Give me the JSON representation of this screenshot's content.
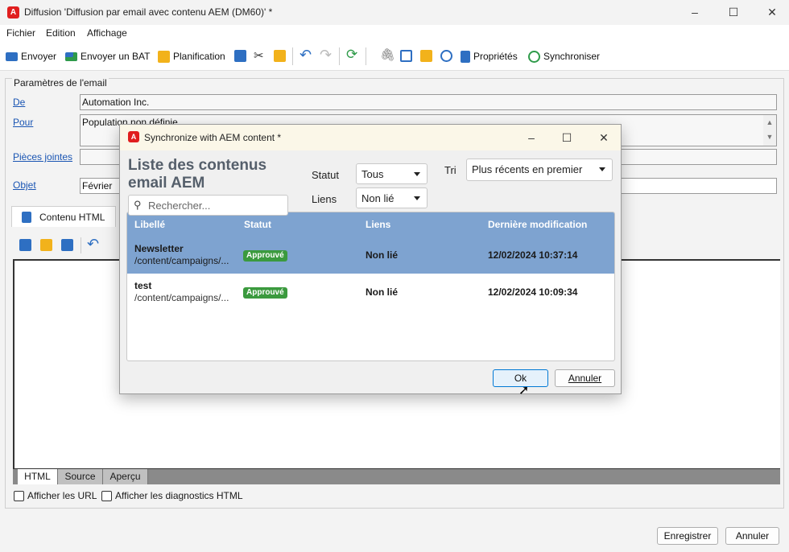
{
  "window": {
    "title": "Diffusion 'Diffusion par email avec contenu AEM (DM60)' *",
    "minimize": "–",
    "maximize": "☐",
    "close": "✕"
  },
  "menu": [
    "Fichier",
    "Edition",
    "Affichage"
  ],
  "toolbar": {
    "send": "Envoyer",
    "send_bat": "Envoyer un BAT",
    "planning": "Planification",
    "properties": "Propriétés",
    "synchronize": "Synchroniser"
  },
  "email_params": {
    "section": "Paramètres de l'email",
    "from_label": "De",
    "from_value": "Automation Inc.",
    "to_label": "Pour",
    "to_value": "Population non définie",
    "attachments_label": "Pièces jointes",
    "subject_label": "Objet",
    "subject_value": "Février"
  },
  "content_tab": "Contenu HTML",
  "bottom_tabs": [
    "HTML",
    "Source",
    "Aperçu"
  ],
  "checkboxes": {
    "show_urls": "Afficher les URL",
    "show_diagnostics": "Afficher les diagnostics HTML"
  },
  "footer": {
    "save": "Enregistrer",
    "cancel": "Annuler"
  },
  "dialog": {
    "title": "Synchronize with AEM content *",
    "heading": "Liste des contenus email AEM",
    "search_placeholder": "Rechercher...",
    "status_label": "Statut",
    "status_value": "Tous",
    "links_label": "Liens",
    "links_value": "Non lié",
    "sort_label": "Tri",
    "sort_value": "Plus récents en premier",
    "columns": [
      "Libellé",
      "Statut",
      "Liens",
      "Dernière modification"
    ],
    "rows": [
      {
        "name": "Newsletter",
        "path": "/content/campaigns/...",
        "status": "Approuvé",
        "links": "Non lié",
        "modified": "12/02/2024 10:37:14",
        "selected": true
      },
      {
        "name": "test",
        "path": "/content/campaigns/...",
        "status": "Approuvé",
        "links": "Non lié",
        "modified": "12/02/2024 10:09:34",
        "selected": false
      }
    ],
    "ok": "Ok",
    "cancel": "Annuler"
  },
  "colors": {
    "accent": "#7ea3d0",
    "approved_badge": "#3b9a3e",
    "app_red": "#e01e1e"
  }
}
